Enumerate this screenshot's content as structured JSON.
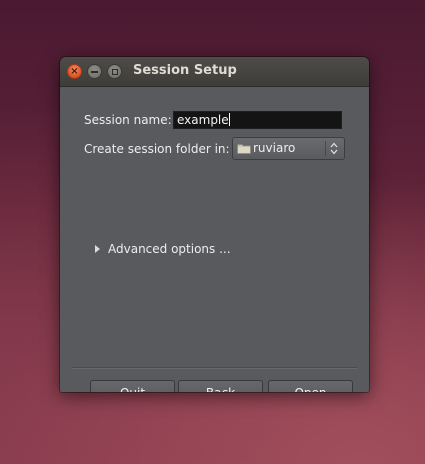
{
  "window": {
    "title": "Session Setup",
    "close_glyph": "×"
  },
  "form": {
    "session_name_label": "Session name:",
    "session_name_value": "example",
    "folder_label": "Create session folder in:",
    "folder_value": "ruviaro",
    "folder_icon": "folder-icon"
  },
  "advanced": {
    "label": "Advanced options ..."
  },
  "buttons": {
    "quit": "Quit",
    "back": "Back",
    "open": "Open"
  },
  "colors": {
    "close_button": "#e15a2a",
    "dialog_background": "#595a5e",
    "titlebar": "#3e3d39"
  }
}
